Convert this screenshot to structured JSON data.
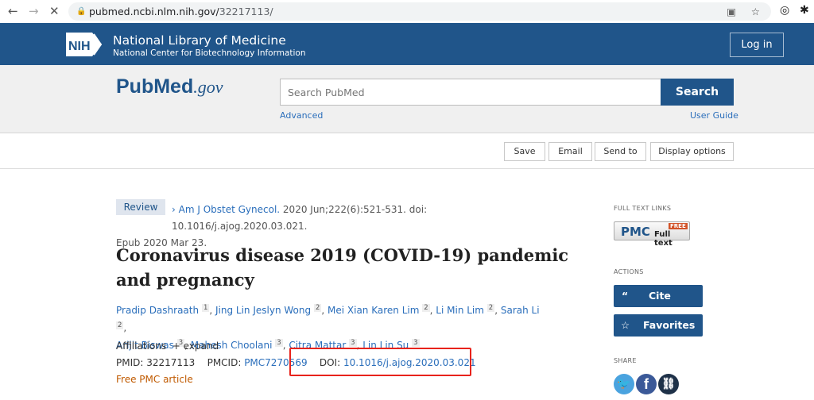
{
  "browser": {
    "url_host": "pubmed.ncbi.nlm.nih.gov/",
    "url_path": "32217113/",
    "back": "←",
    "forward": "→",
    "stop": "✕"
  },
  "header": {
    "logo": "NIH",
    "title": "National Library of Medicine",
    "subtitle": "National Center for Biotechnology Information",
    "login": "Log in"
  },
  "search": {
    "logo_main": "PubMed",
    "logo_suffix": ".gov",
    "placeholder": "Search PubMed",
    "button": "Search",
    "advanced": "Advanced",
    "user_guide": "User Guide"
  },
  "toolbar": {
    "save": "Save",
    "email": "Email",
    "send_to": "Send to",
    "display_options": "Display options"
  },
  "article": {
    "type_badge": "Review",
    "journal": "Am J Obstet Gynecol.",
    "citation": " 2020 Jun;222(6):521-531. doi: 10.1016/j.ajog.2020.03.021.",
    "epub": "Epub 2020 Mar 23.",
    "title": "Coronavirus disease 2019 (COVID-19) pandemic and pregnancy",
    "authors": [
      {
        "name": "Pradip Dashraath",
        "aff": "1"
      },
      {
        "name": "Jing Lin Jeslyn Wong",
        "aff": "2"
      },
      {
        "name": "Mei Xian Karen Lim",
        "aff": "2"
      },
      {
        "name": "Li Min Lim",
        "aff": "2"
      },
      {
        "name": "Sarah Li",
        "aff": "2"
      },
      {
        "name": "Arijit Biswas",
        "aff": "3"
      },
      {
        "name": "Mahesh Choolani",
        "aff": "3"
      },
      {
        "name": "Citra Mattar",
        "aff": "3"
      },
      {
        "name": "Lin Lin Su",
        "aff": "3"
      }
    ],
    "affiliations_label": "Affiliations",
    "expand": "+ expand",
    "pmid_label": "PMID: ",
    "pmid": "32217113",
    "pmcid_label": "PMCID: ",
    "pmcid": "PMC7270569",
    "doi_label": "DOI: ",
    "doi": "10.1016/j.ajog.2020.03.021",
    "free_pmc": "Free PMC article"
  },
  "sidebar": {
    "full_text_heading": "FULL TEXT LINKS",
    "pmc_logo": "PMC",
    "pmc_free": "FREE",
    "pmc_full": "Full text",
    "actions_heading": "ACTIONS",
    "cite": "Cite",
    "favorites": "Favorites",
    "share_heading": "SHARE"
  },
  "colors": {
    "brand": "#20558a",
    "link": "#2a6ebb",
    "highlight": "#e8231c",
    "free": "#c05a00"
  }
}
